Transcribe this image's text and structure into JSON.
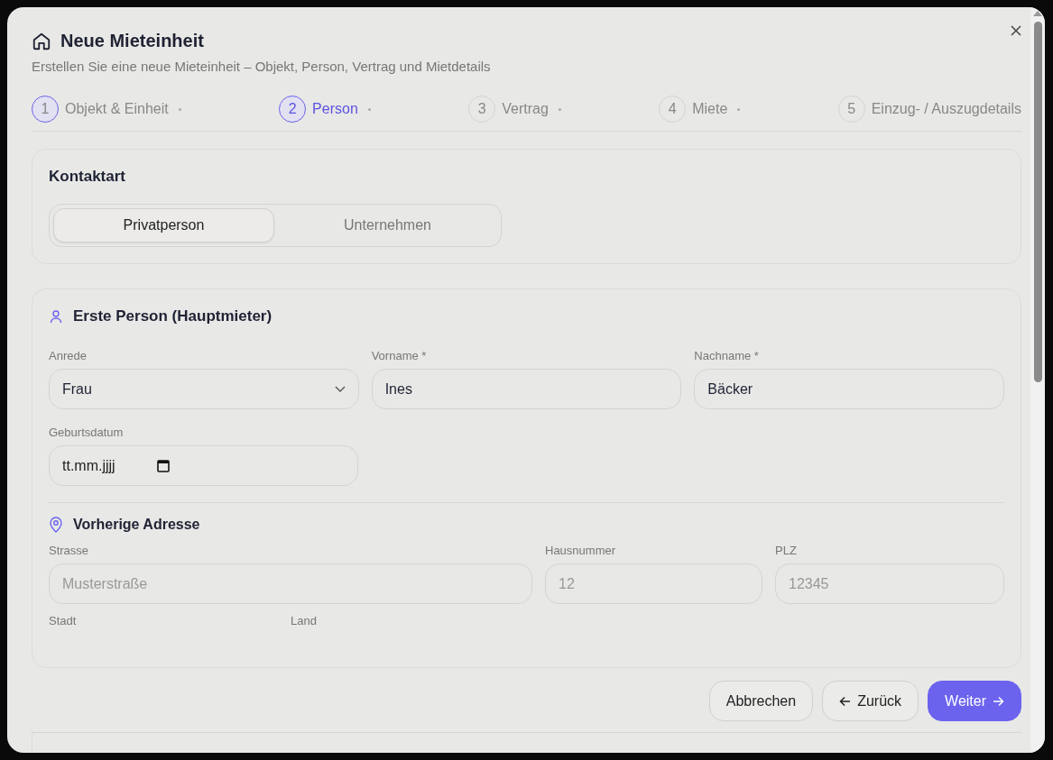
{
  "dialog": {
    "title": "Neue Mieteinheit",
    "subtitle": "Erstellen Sie eine neue Mieteinheit – Objekt, Person, Vertrag und Mietdetails"
  },
  "steps": [
    {
      "number": "1",
      "label": "Objekt & Einheit",
      "completed": true,
      "selected": false
    },
    {
      "number": "2",
      "label": "Person",
      "completed": false,
      "selected": true
    },
    {
      "number": "3",
      "label": "Vertrag",
      "completed": false,
      "selected": false
    },
    {
      "number": "4",
      "label": "Miete",
      "completed": false,
      "selected": false
    },
    {
      "number": "5",
      "label": "Einzug- / Auszugdetails",
      "completed": false,
      "selected": false
    }
  ],
  "contact_type": {
    "title": "Kontaktart",
    "options": [
      {
        "label": "Privatperson",
        "selected": true
      },
      {
        "label": "Unternehmen",
        "selected": false
      }
    ]
  },
  "person": {
    "title": "Erste Person (Hauptmieter)",
    "rows": [
      [
        {
          "label": "Anrede",
          "kind": "select",
          "value": "Frau"
        },
        {
          "label": "Vorname *",
          "kind": "text",
          "value": "Ines"
        },
        {
          "label": "Nachname *",
          "kind": "text",
          "value": "Bäcker"
        }
      ],
      [
        {
          "label": "Geburtsdatum",
          "kind": "date",
          "placeholder": "tt.mm.jjjj"
        }
      ]
    ]
  },
  "address": {
    "title": "Vorherige Adresse",
    "fields": [
      {
        "label": "Strasse",
        "placeholder": "Musterstraße"
      },
      {
        "label": "Hausnummer",
        "placeholder": "12"
      },
      {
        "label": "PLZ",
        "placeholder": "12345"
      }
    ],
    "cut_labels": [
      "Stadt",
      "Land"
    ]
  },
  "buttons": [
    {
      "label": "Abbrechen",
      "kind": "secondary"
    },
    {
      "label": "Zurück",
      "kind": "back"
    },
    {
      "label": "Weiter",
      "kind": "primary"
    }
  ]
}
